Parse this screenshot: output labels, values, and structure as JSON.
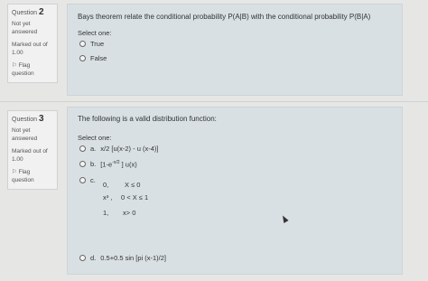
{
  "q2": {
    "label": "Question",
    "number": "2",
    "status": "Not yet answered",
    "marks": "Marked out of 1.00",
    "flag": "Flag question",
    "text": "Bays theorem relate the conditional probability P(A|B) with the conditional probability P(B|A)",
    "select_one": "Select one:",
    "options": [
      "True",
      "False"
    ]
  },
  "q3": {
    "label": "Question",
    "number": "3",
    "status": "Not yet answered",
    "marks": "Marked out of 1.00",
    "flag": "Flag question",
    "text": "The following is a valid distribution function:",
    "select_one": "Select one:",
    "opt_a_letter": "a.",
    "opt_a": "x/2 [u(x-2) - u (x-4)]",
    "opt_b_letter": "b.",
    "opt_b_pre": "[1-e",
    "opt_b_sup": "-x/2",
    "opt_b_post": " ] u(x)",
    "opt_c_letter": "c.",
    "opt_c_rows": [
      {
        "val": "0,",
        "cond": "X ≤ 0"
      },
      {
        "val": "x³ ,",
        "cond": "0 < X ≤ 1"
      },
      {
        "val": "1,",
        "cond": "x> 0"
      }
    ],
    "opt_d_letter": "d.",
    "opt_d": "0.5+0.5 sin [pi (x-1)/2]"
  }
}
